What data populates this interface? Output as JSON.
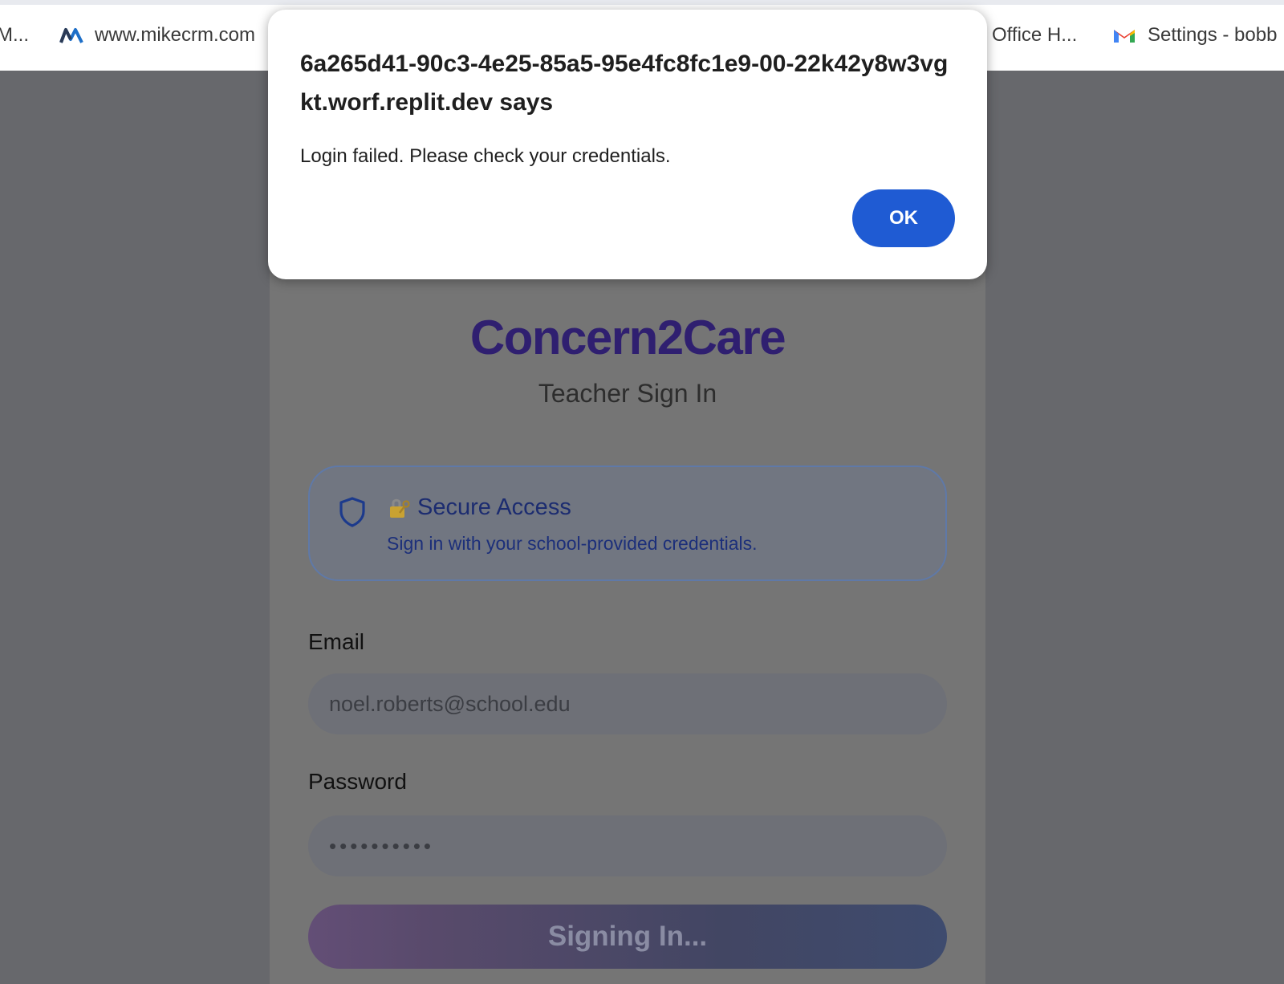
{
  "bookmarks": [
    {
      "label": "M...",
      "icon": "bookmark-favicon"
    },
    {
      "label": "www.mikecrm.com",
      "icon": "mikecrm-logo-icon"
    },
    {
      "label": "Office H...",
      "icon": ""
    },
    {
      "label": "Settings - bobb",
      "icon": "gmail-icon"
    }
  ],
  "login": {
    "brand": "Concern2Care",
    "subtitle": "Teacher Sign In",
    "notice_title": "Secure Access",
    "notice_desc": "Sign in with your school-provided credentials.",
    "email_label": "Email",
    "email_value": "noel.roberts@school.edu",
    "password_label": "Password",
    "password_mask": "••••••••••",
    "submit_label": "Signing In..."
  },
  "dialog": {
    "title": "6a265d41-90c3-4e25-85a5-95e4fc8fc1e9-00-22k42y8w3vgkt.worf.replit.dev says",
    "message": "Login failed. Please check your credentials.",
    "ok_label": "OK"
  },
  "colors": {
    "brand": "#2f1f70",
    "ok_button": "#1f5bd3",
    "notice_text": "#1c2c70"
  }
}
